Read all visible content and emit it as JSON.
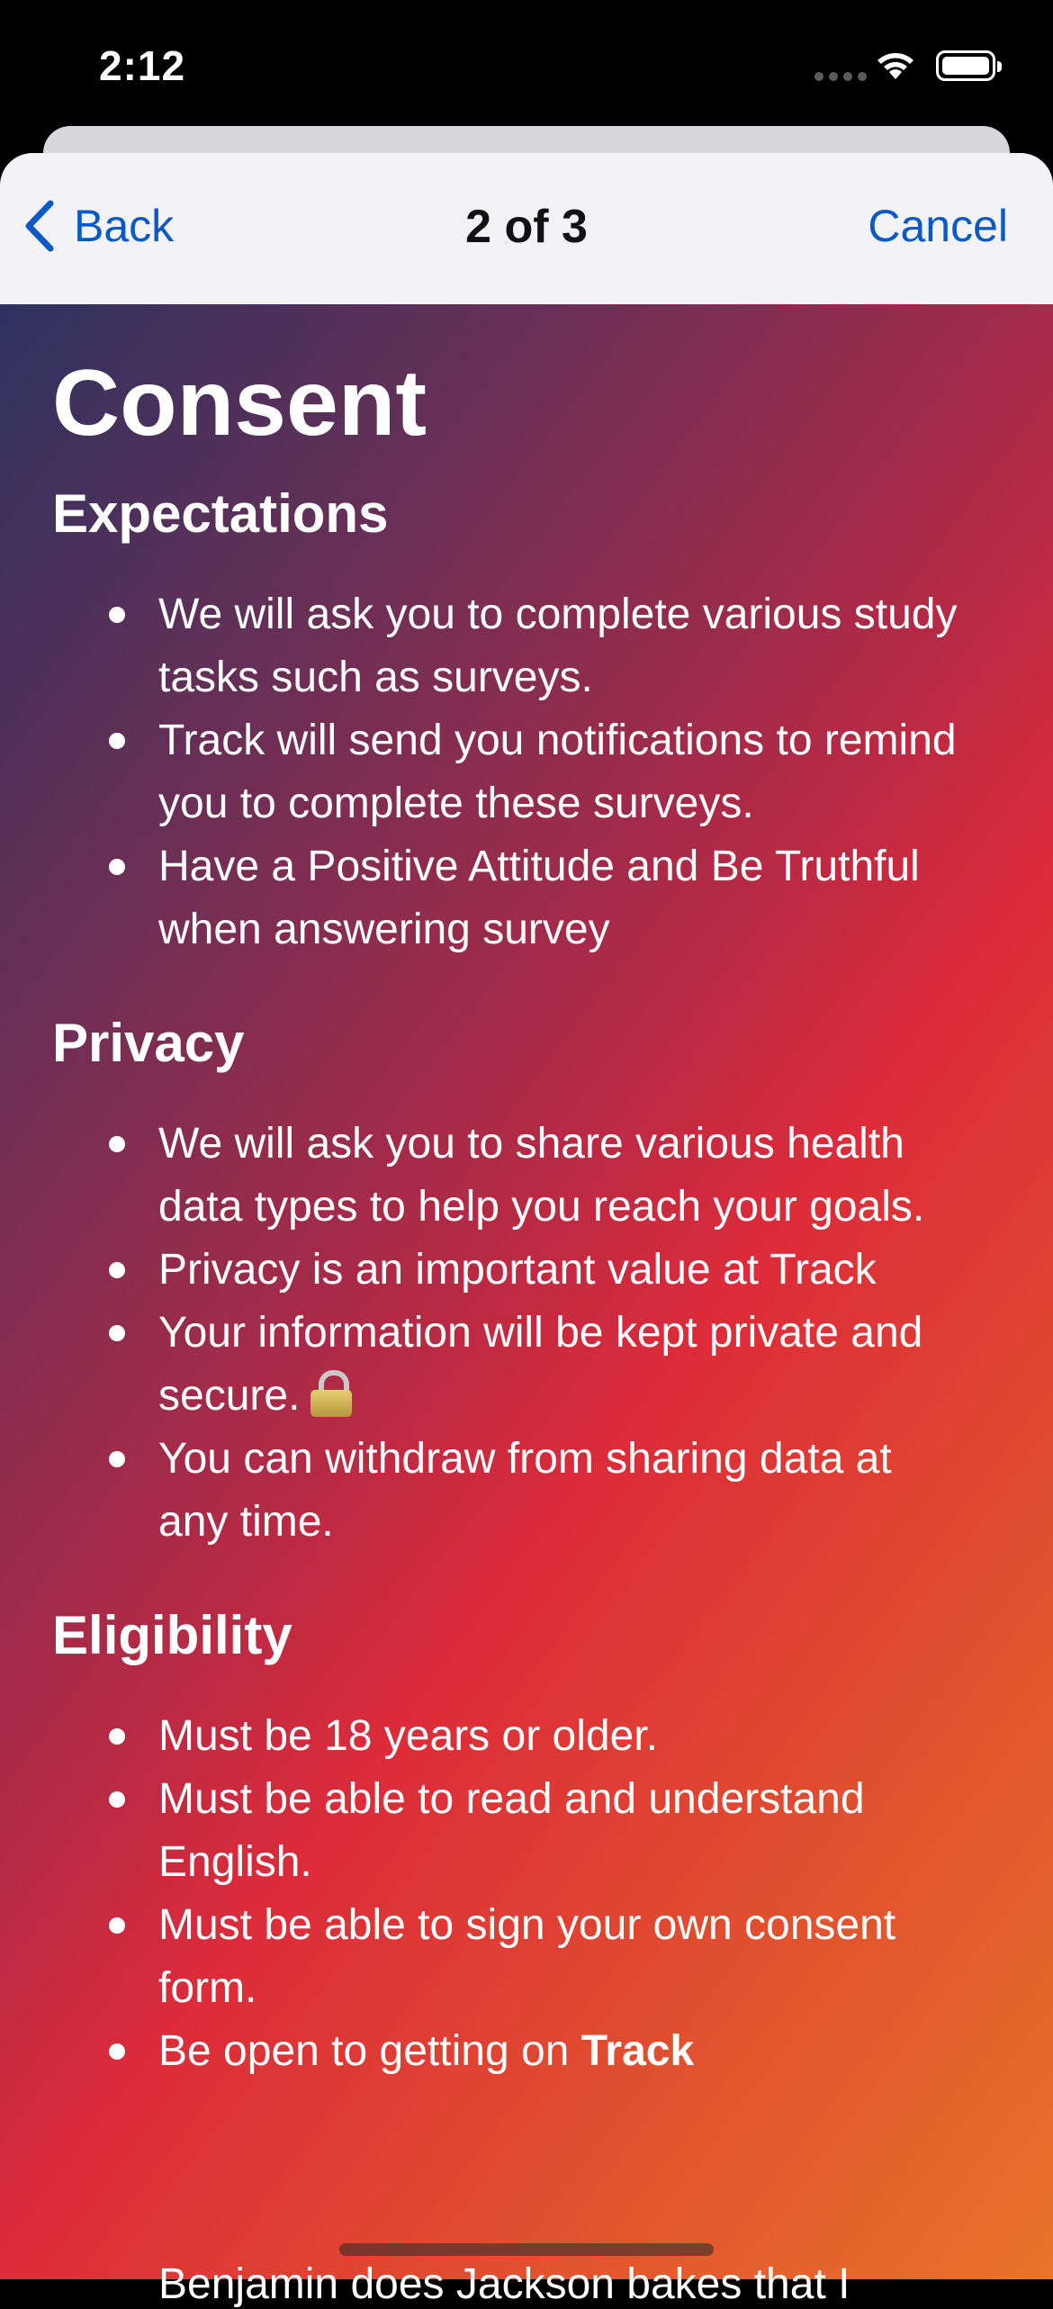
{
  "status_bar": {
    "time": "2:12"
  },
  "nav": {
    "back_label": "Back",
    "title": "2 of 3",
    "cancel_label": "Cancel"
  },
  "page": {
    "heading": "Consent",
    "sections": [
      {
        "title": "Expectations",
        "items": [
          [
            "We will ask you to complete various study",
            "tasks such as surveys."
          ],
          [
            "Track will send you notifications to remind",
            "you to complete these surveys."
          ],
          [
            "Have a Positive Attitude and Be Truthful",
            "when answering survey"
          ]
        ]
      },
      {
        "title": "Privacy",
        "items": [
          [
            "We will ask you to share various health",
            "data types to help you reach your goals."
          ],
          [
            "Privacy is an important value at Track"
          ],
          [
            "Your information will be kept private and",
            "secure."
          ],
          [
            "You can withdraw from sharing data at",
            "any time."
          ]
        ]
      },
      {
        "title": "Eligibility",
        "items": [
          [
            "Must be 18 years or older."
          ],
          [
            "Must be able to read and understand",
            "English."
          ],
          [
            "Must be able to sign your own consent",
            "form."
          ],
          [
            "Be open to getting on "
          ]
        ],
        "bold_suffix": "Track"
      }
    ],
    "cut_off_line": "Benjamin does Jackson bakes that I"
  },
  "icons": {
    "lock": "lock-icon",
    "back": "chevron-left-icon"
  },
  "colors": {
    "accent": "#0a59c4",
    "nav_bg": "#f2f2f7"
  }
}
